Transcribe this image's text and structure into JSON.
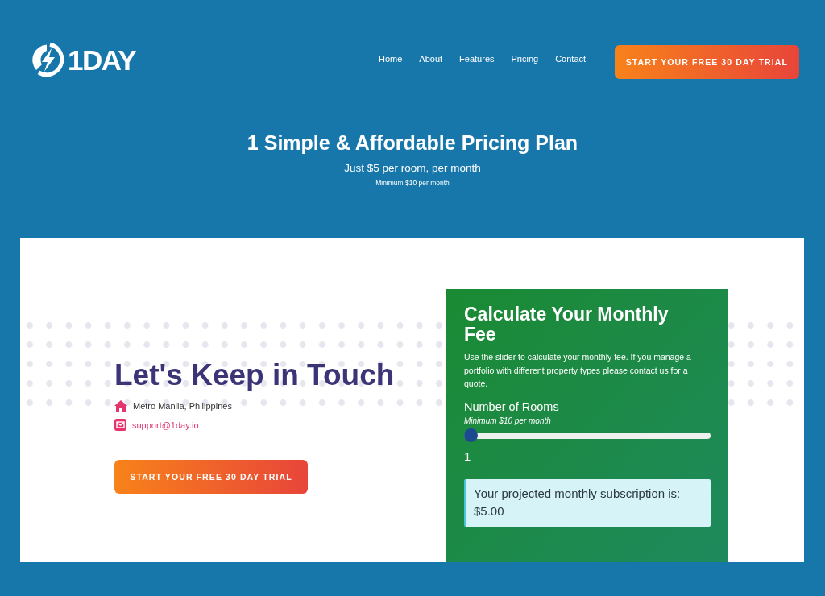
{
  "header": {
    "logo_text": "1DAY",
    "nav": [
      "Home",
      "About",
      "Features",
      "Pricing",
      "Contact"
    ],
    "cta": "START YOUR FREE 30 DAY TRIAL"
  },
  "hero": {
    "title": "1 Simple & Affordable Pricing Plan",
    "subtitle": "Just $5 per room, per month",
    "note": "Minimum $10 per month"
  },
  "contact": {
    "heading": "Let's Keep in Touch",
    "address": "Metro Manila, Philippines",
    "email": "support@1day.io",
    "cta": "START YOUR FREE 30 DAY TRIAL"
  },
  "calculator": {
    "title": "Calculate Your Monthly Fee",
    "description": "Use the slider to calculate your monthly fee. If you manage a portfolio with different property types please contact us for a quote.",
    "rooms_label": "Number of Rooms",
    "rooms_note": "Minimum $10 per month",
    "slider": {
      "level": 0
    },
    "rooms_value": "1",
    "result": {
      "text": "Your projected monthly subscription is:",
      "amount": "$5.00"
    }
  }
}
